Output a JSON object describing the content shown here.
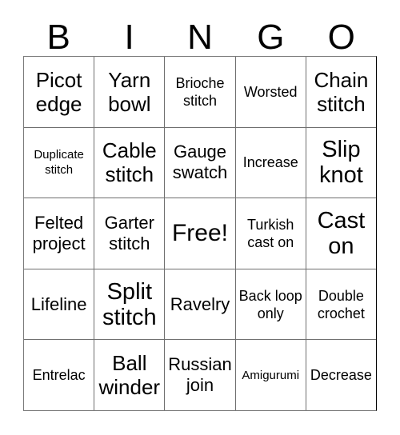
{
  "card": {
    "title_letters": [
      "B",
      "I",
      "N",
      "G",
      "O"
    ],
    "free_space": {
      "label": "Free!",
      "row": 2,
      "col": 2
    },
    "rows": [
      [
        {
          "text": "Picot edge",
          "size": "fs-lg"
        },
        {
          "text": "Yarn bowl",
          "size": "fs-lg"
        },
        {
          "text": "Brioche stitch",
          "size": "fs-sm"
        },
        {
          "text": "Worsted",
          "size": "fs-sm"
        },
        {
          "text": "Chain stitch",
          "size": "fs-lg"
        }
      ],
      [
        {
          "text": "Duplicate stitch",
          "size": "fs-xs"
        },
        {
          "text": "Cable stitch",
          "size": "fs-lg"
        },
        {
          "text": "Gauge swatch",
          "size": "fs-md"
        },
        {
          "text": "Increase",
          "size": "fs-sm"
        },
        {
          "text": "Slip knot",
          "size": "fs-xl"
        }
      ],
      [
        {
          "text": "Felted project",
          "size": "fs-md"
        },
        {
          "text": "Garter stitch",
          "size": "fs-md"
        },
        {
          "text": "Free!",
          "size": "fs-free"
        },
        {
          "text": "Turkish cast on",
          "size": "fs-sm"
        },
        {
          "text": "Cast on",
          "size": "fs-xl"
        }
      ],
      [
        {
          "text": "Lifeline",
          "size": "fs-md"
        },
        {
          "text": "Split stitch",
          "size": "fs-xl"
        },
        {
          "text": "Ravelry",
          "size": "fs-md"
        },
        {
          "text": "Back loop only",
          "size": "fs-sm"
        },
        {
          "text": "Double crochet",
          "size": "fs-sm"
        }
      ],
      [
        {
          "text": "Entrelac",
          "size": "fs-sm"
        },
        {
          "text": "Ball winder",
          "size": "fs-lg"
        },
        {
          "text": "Russian join",
          "size": "fs-md"
        },
        {
          "text": "Amigurumi",
          "size": "fs-xs"
        },
        {
          "text": "Decrease",
          "size": "fs-sm"
        }
      ]
    ]
  },
  "colors": {
    "background": "#ffffff",
    "text": "#000000",
    "grid_line": "#6f6f6f",
    "grid_outer": "#7a7a7a"
  }
}
